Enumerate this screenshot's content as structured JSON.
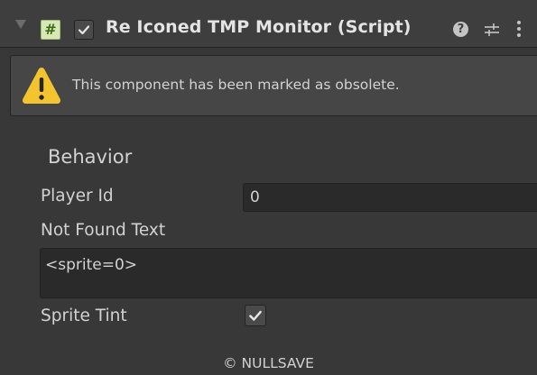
{
  "component": {
    "title": "Re Iconed TMP Monitor (Script)",
    "script_icon_glyph": "#",
    "enabled": true,
    "icons": {
      "foldout": "foldout-triangle-icon",
      "script": "cs-script-icon",
      "help": "help-icon",
      "presets": "presets-icon",
      "menu": "kebab-menu-icon",
      "help_glyph": "?"
    }
  },
  "warning": {
    "icon": "warning-icon",
    "text": "This component has been marked as obsolete."
  },
  "section": {
    "title": "Behavior"
  },
  "fields": {
    "player_id": {
      "label": "Player Id",
      "value": "0"
    },
    "not_found_text": {
      "label": "Not Found Text",
      "value": "<sprite=0>"
    },
    "sprite_tint": {
      "label": "Sprite Tint",
      "checked": true
    }
  },
  "footer": {
    "text": "© NULLSAVE"
  },
  "colors": {
    "background": "#383838",
    "header": "#3e3e3e",
    "field": "#2a2a2a",
    "warning_yellow": "#f4c430",
    "text": "#d2d2d2"
  }
}
